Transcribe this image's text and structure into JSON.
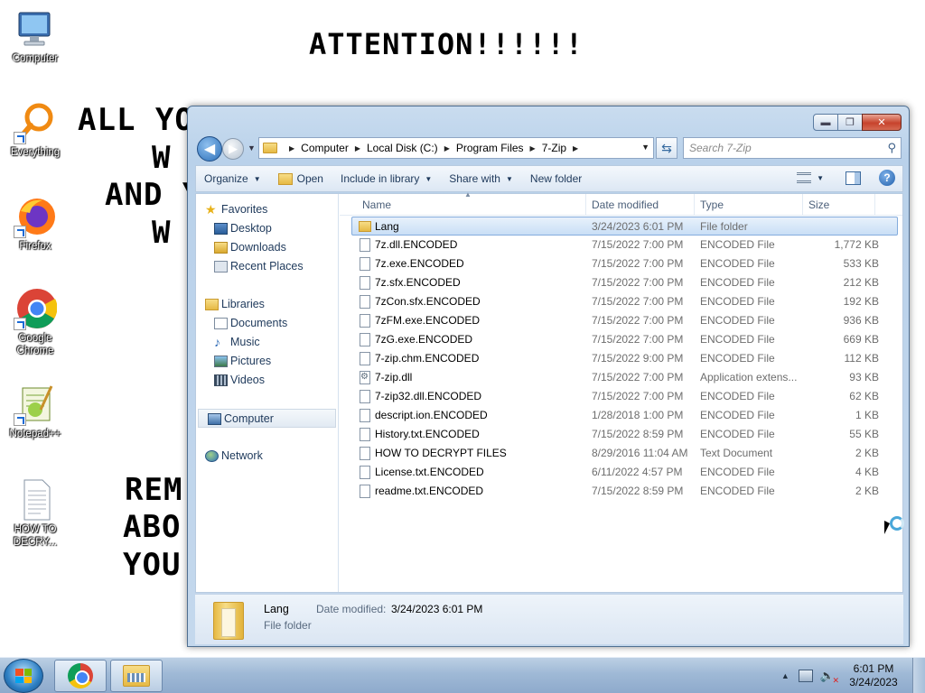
{
  "desktop": {
    "note_title": "ATTENTION!!!!!!",
    "note_fragments": [
      "ALL YO",
      "W",
      "AND Y",
      "W",
      "REM",
      "ABO",
      "YOU"
    ],
    "icons": [
      {
        "label": "Computer",
        "icon": "computer-icon"
      },
      {
        "label": "Everything",
        "icon": "everything-icon"
      },
      {
        "label": "Firefox",
        "icon": "firefox-icon"
      },
      {
        "label": "Google Chrome",
        "icon": "chrome-icon"
      },
      {
        "label": "Notepad++",
        "icon": "notepadpp-icon"
      },
      {
        "label": "HOW TO DECRY...",
        "icon": "text-file-icon"
      }
    ]
  },
  "window": {
    "caption_buttons": {
      "minimize": "▬",
      "maximize": "❐",
      "close": "✕"
    },
    "address": {
      "crumbs": [
        "Computer",
        "Local Disk (C:)",
        "Program Files",
        "7-Zip"
      ]
    },
    "search": {
      "placeholder": "Search 7-Zip"
    },
    "toolbar": {
      "organize": "Organize",
      "open": "Open",
      "include_in_library": "Include in library",
      "share_with": "Share with",
      "new_folder": "New folder"
    },
    "nav": {
      "favorites": "Favorites",
      "desktop": "Desktop",
      "downloads": "Downloads",
      "recent_places": "Recent Places",
      "libraries": "Libraries",
      "documents": "Documents",
      "music": "Music",
      "pictures": "Pictures",
      "videos": "Videos",
      "computer": "Computer",
      "network": "Network"
    },
    "columns": {
      "name": "Name",
      "date_modified": "Date modified",
      "type": "Type",
      "size": "Size"
    },
    "files": [
      {
        "name": "Lang",
        "date": "3/24/2023 6:01 PM",
        "type": "File folder",
        "size": ""
      },
      {
        "name": "7z.dll.ENCODED",
        "date": "7/15/2022 7:00 PM",
        "type": "ENCODED File",
        "size": "1,772 KB"
      },
      {
        "name": "7z.exe.ENCODED",
        "date": "7/15/2022 7:00 PM",
        "type": "ENCODED File",
        "size": "533 KB"
      },
      {
        "name": "7z.sfx.ENCODED",
        "date": "7/15/2022 7:00 PM",
        "type": "ENCODED File",
        "size": "212 KB"
      },
      {
        "name": "7zCon.sfx.ENCODED",
        "date": "7/15/2022 7:00 PM",
        "type": "ENCODED File",
        "size": "192 KB"
      },
      {
        "name": "7zFM.exe.ENCODED",
        "date": "7/15/2022 7:00 PM",
        "type": "ENCODED File",
        "size": "936 KB"
      },
      {
        "name": "7zG.exe.ENCODED",
        "date": "7/15/2022 7:00 PM",
        "type": "ENCODED File",
        "size": "669 KB"
      },
      {
        "name": "7-zip.chm.ENCODED",
        "date": "7/15/2022 9:00 PM",
        "type": "ENCODED File",
        "size": "112 KB"
      },
      {
        "name": "7-zip.dll",
        "date": "7/15/2022 7:00 PM",
        "type": "Application extens...",
        "size": "93 KB"
      },
      {
        "name": "7-zip32.dll.ENCODED",
        "date": "7/15/2022 7:00 PM",
        "type": "ENCODED File",
        "size": "62 KB"
      },
      {
        "name": "descript.ion.ENCODED",
        "date": "1/28/2018 1:00 PM",
        "type": "ENCODED File",
        "size": "1 KB"
      },
      {
        "name": "History.txt.ENCODED",
        "date": "7/15/2022 8:59 PM",
        "type": "ENCODED File",
        "size": "55 KB"
      },
      {
        "name": "HOW TO DECRYPT FILES",
        "date": "8/29/2016 11:04 AM",
        "type": "Text Document",
        "size": "2 KB"
      },
      {
        "name": "License.txt.ENCODED",
        "date": "6/11/2022 4:57 PM",
        "type": "ENCODED File",
        "size": "4 KB"
      },
      {
        "name": "readme.txt.ENCODED",
        "date": "7/15/2022 8:59 PM",
        "type": "ENCODED File",
        "size": "2 KB"
      }
    ],
    "details": {
      "name": "Lang",
      "date_label": "Date modified:",
      "date_value": "3/24/2023 6:01 PM",
      "type": "File folder"
    }
  },
  "taskbar": {
    "clock_time": "6:01 PM",
    "clock_date": "3/24/2023"
  }
}
